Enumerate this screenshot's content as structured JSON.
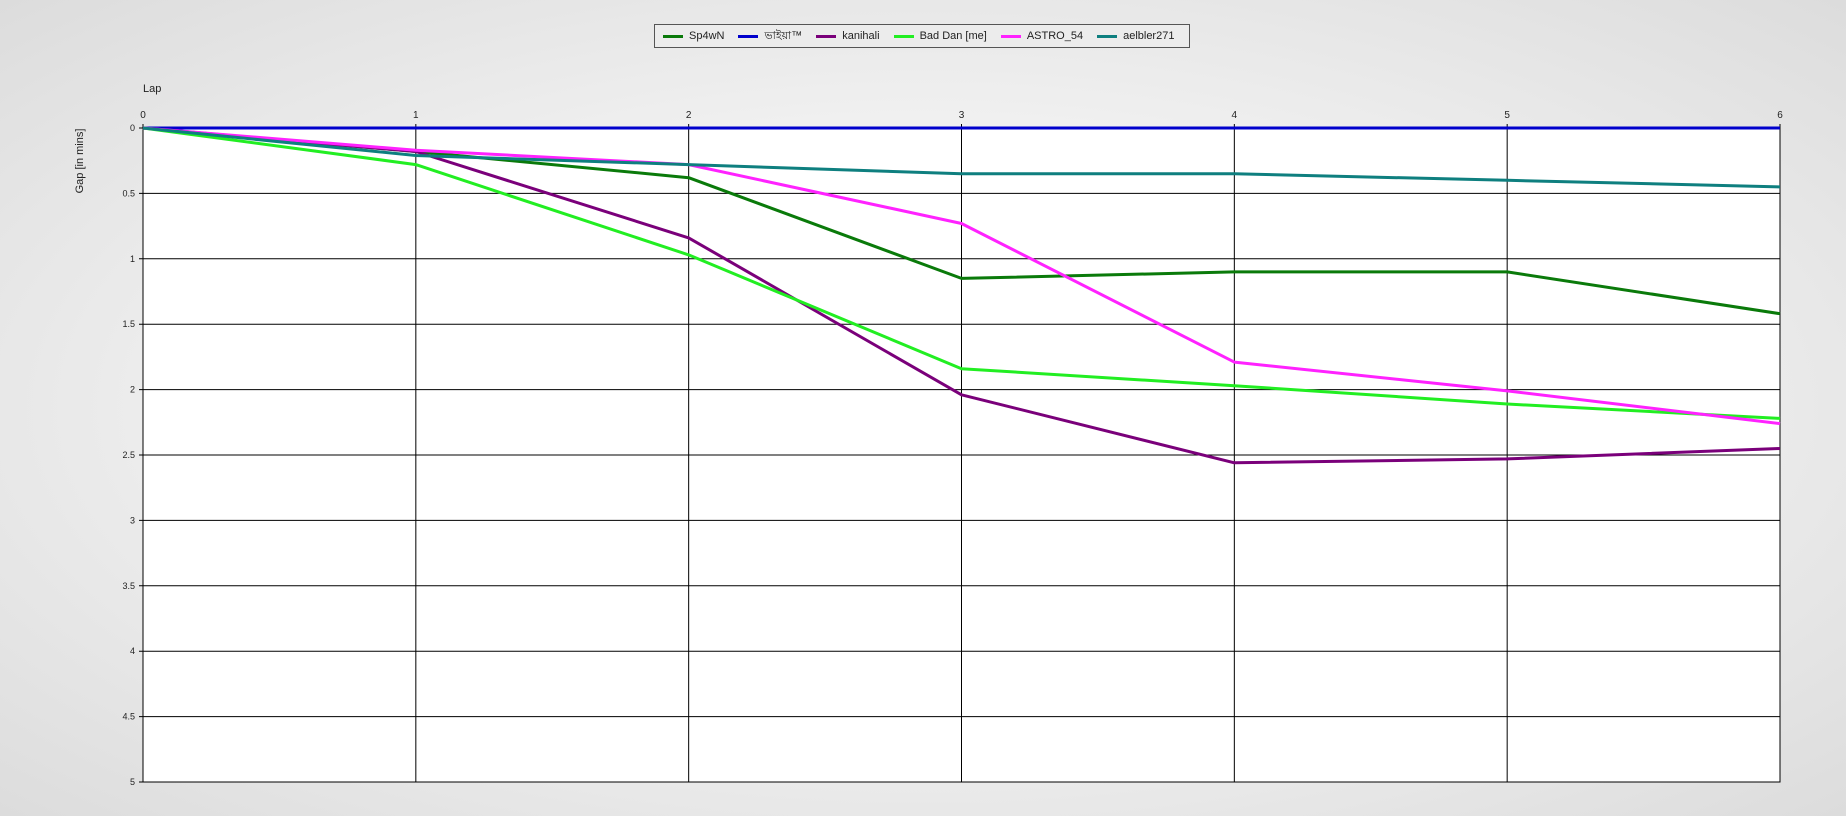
{
  "chart_data": {
    "type": "line",
    "xlabel": "Lap",
    "ylabel": "Gap [in mins]",
    "xlim": [
      0,
      6
    ],
    "ylim": [
      0,
      5
    ],
    "y_inverted": true,
    "x_ticks": [
      0,
      1,
      2,
      3,
      4,
      5,
      6
    ],
    "x_tick_labels": [
      "0",
      "1",
      "2",
      "3",
      "4",
      "5",
      "6"
    ],
    "y_ticks": [
      0,
      0.5,
      1,
      1.5,
      2,
      2.5,
      3,
      3.5,
      4,
      4.5,
      5
    ],
    "y_tick_labels": [
      "0",
      "0.5",
      "1",
      "1.5",
      "2",
      "2.5",
      "3",
      "3.5",
      "4",
      "4.5",
      "5"
    ],
    "grid": true,
    "legend_position": "top-center",
    "x": [
      0,
      1,
      2,
      3,
      4,
      5,
      6
    ],
    "series": [
      {
        "name": "Sp4wN",
        "color": "#0a7a0a",
        "values": [
          0,
          0.18,
          0.38,
          1.15,
          1.1,
          1.1,
          1.42
        ]
      },
      {
        "name": "ভাইয়া™",
        "color": "#0000cc",
        "values": [
          0,
          0,
          0,
          0,
          0,
          0,
          0
        ]
      },
      {
        "name": "kanihali",
        "color": "#7a007a",
        "values": [
          0,
          0.18,
          0.84,
          2.04,
          2.56,
          2.53,
          2.45
        ]
      },
      {
        "name": "Bad Dan [me]",
        "color": "#22ee22",
        "values": [
          0,
          0.28,
          0.97,
          1.84,
          1.97,
          2.11,
          2.22
        ]
      },
      {
        "name": "ASTRO_54",
        "color": "#ff22ff",
        "values": [
          0,
          0.17,
          0.28,
          0.73,
          1.79,
          2.01,
          2.26
        ]
      },
      {
        "name": "aelbler271",
        "color": "#0e7f7f",
        "values": [
          0,
          0.21,
          0.28,
          0.35,
          0.35,
          0.4,
          0.45
        ]
      }
    ]
  }
}
